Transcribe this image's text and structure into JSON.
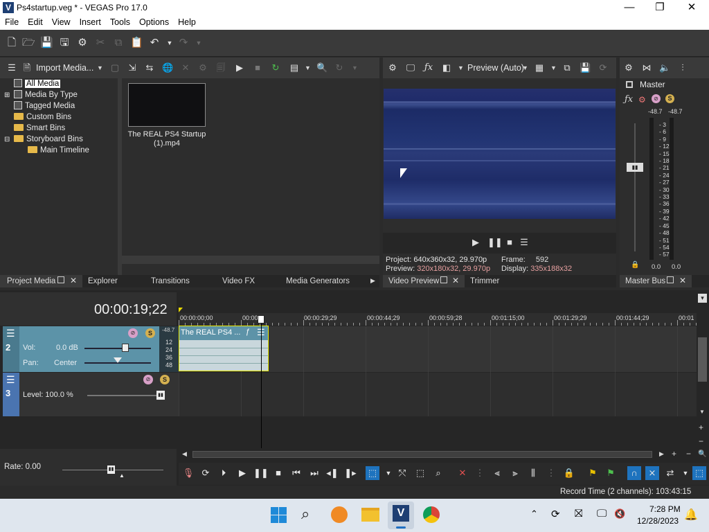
{
  "window": {
    "title": "Ps4startup.veg * - VEGAS Pro 17.0",
    "logo": "V"
  },
  "menu": [
    "File",
    "Edit",
    "View",
    "Insert",
    "Tools",
    "Options",
    "Help"
  ],
  "project_media": {
    "import_label": "Import Media...",
    "tree": [
      {
        "label": "All Media",
        "selected": true,
        "expander": "",
        "icon": "bin"
      },
      {
        "label": "Media By Type",
        "expander": "+",
        "icon": "bin"
      },
      {
        "label": "Tagged Media",
        "expander": "",
        "icon": "bin"
      },
      {
        "label": "Custom Bins",
        "expander": "",
        "icon": "folder"
      },
      {
        "label": "Smart Bins",
        "expander": "",
        "icon": "folder"
      },
      {
        "label": "Storyboard Bins",
        "expander": "−",
        "icon": "folder"
      },
      {
        "label": "Main Timeline",
        "expander": "",
        "icon": "folder",
        "indent": true
      }
    ],
    "media_item": "The REAL PS4 Startup (1).mp4"
  },
  "left_tabs": [
    "Project Media",
    "Explorer",
    "Transitions",
    "Video FX",
    "Media Generators"
  ],
  "preview": {
    "mode": "Preview (Auto)",
    "project_label": "Project:",
    "project_value": "640x360x32, 29.970p",
    "preview_label": "Preview:",
    "preview_value": "320x180x32, 29.970p",
    "frame_label": "Frame:",
    "frame_value": "592",
    "display_label": "Display:",
    "display_value": "335x188x32",
    "tabs": [
      "Video Preview",
      "Trimmer"
    ]
  },
  "master": {
    "label": "Master",
    "peak_left": "-48.7",
    "peak_right": "-48.7",
    "scale": [
      "3",
      "6",
      "9",
      "12",
      "15",
      "18",
      "21",
      "24",
      "27",
      "30",
      "33",
      "36",
      "39",
      "42",
      "45",
      "48",
      "51",
      "54",
      "57"
    ],
    "val_left": "0.0",
    "val_right": "0.0",
    "tab": "Master Bus"
  },
  "timeline": {
    "timecode": "00:00:19;22",
    "ruler": [
      "00:00:00;00",
      "00:00:",
      "00:00:29;29",
      "00:00:44;29",
      "00:00:59;28",
      "00:01:15;00",
      "00:01:29;29",
      "00:01:44;29",
      "00:01"
    ],
    "track2": {
      "num": "2",
      "vol_label": "Vol:",
      "vol_value": "0.0 dB",
      "pan_label": "Pan:",
      "pan_value": "Center",
      "peak": "-48.7",
      "meter": [
        "12",
        "24",
        "36",
        "48"
      ]
    },
    "track3": {
      "num": "3",
      "level_label": "Level: 100.0 %"
    },
    "clip_label": "The REAL PS4 ...",
    "rate_label": "Rate: 0.00"
  },
  "status": {
    "record_time": "Record Time (2 channels): 103:43:15"
  },
  "taskbar": {
    "time": "7:28 PM",
    "date": "12/28/2023"
  },
  "colors": {
    "accent": "#1e73be",
    "preview_bg": "#1e2d6b",
    "clip": "#8fb8c8",
    "track_header": "#5c93a8"
  }
}
